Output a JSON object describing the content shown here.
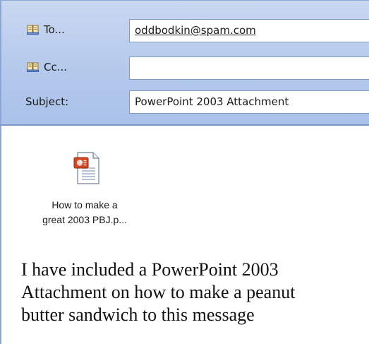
{
  "header": {
    "to_label": "To...",
    "cc_label": "Cc...",
    "subject_label": "Subject:",
    "to_value": "oddbodkin@spam.com",
    "cc_value": "",
    "subject_value": "PowerPoint 2003 Attachment"
  },
  "attachment": {
    "icon": "powerpoint-file-icon",
    "name_line1": "How to make a",
    "name_line2": "great 2003 PBJ.p..."
  },
  "message": {
    "line1": "I have included a PowerPoint 2003",
    "line2": "Attachment on how to make a peanut",
    "line3": "butter sandwich to this message"
  },
  "colors": {
    "header_bg": "#b5c9ec",
    "field_border": "#7f9db9",
    "ppt_accent": "#d24726"
  }
}
